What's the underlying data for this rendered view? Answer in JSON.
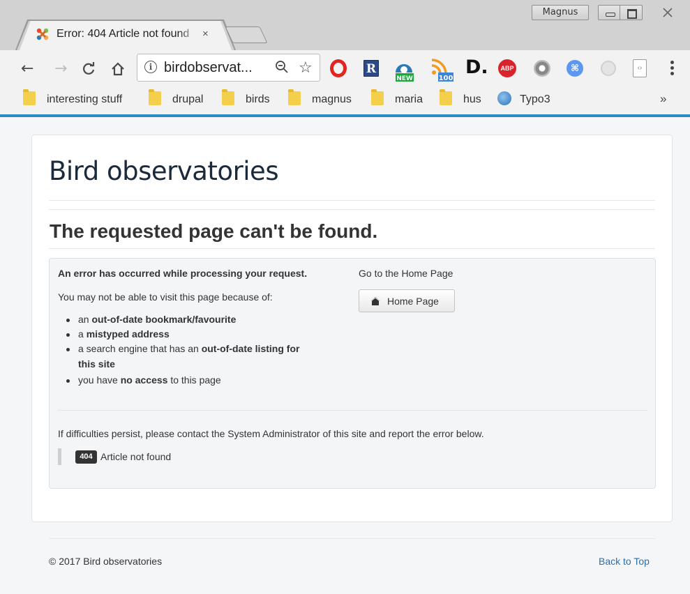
{
  "browser": {
    "profile_name": "Magnus",
    "tab_title": "Error: 404 Article not found",
    "tab_close": "×",
    "url_display": "birdobservat...",
    "ext_r_label": "R",
    "ext_new_label": "NEW",
    "ext_rss_count": "100",
    "ext_d_label": "D.",
    "ext_abp_label": "ABP",
    "bookmarks": [
      {
        "label": "interesting stuff",
        "icon": "folder-icon"
      },
      {
        "label": "drupal",
        "icon": "folder-icon"
      },
      {
        "label": "birds",
        "icon": "folder-icon"
      },
      {
        "label": "magnus",
        "icon": "folder-icon"
      },
      {
        "label": "maria",
        "icon": "folder-icon"
      },
      {
        "label": "hus",
        "icon": "folder-icon"
      },
      {
        "label": "Typo3",
        "icon": "globe-icon"
      }
    ],
    "bookmarks_more": "»",
    "accent_color": "#2a8bcb"
  },
  "page": {
    "site_title": "Bird observatories",
    "heading": "The requested page can't be found.",
    "error_intro": "An error has occurred while processing your request.",
    "reasons_intro": "You may not be able to visit this page because of:",
    "reasons": [
      {
        "pre": "an ",
        "bold": "out-of-date bookmark/favourite",
        "post": ""
      },
      {
        "pre": "a ",
        "bold": "mistyped address",
        "post": ""
      },
      {
        "pre": "a search engine that has an ",
        "bold": "out-of-date listing for",
        "post": ""
      },
      {
        "pre": "",
        "bold": "this site",
        "post": ""
      },
      {
        "pre": "you have ",
        "bold": "no access",
        "post": " to this page"
      }
    ],
    "go_home_text": "Go to the Home Page",
    "home_button": "Home Page",
    "contact_text": "If difficulties persist, please contact the System Administrator of this site and report the error below.",
    "error_code": "404",
    "error_message": "Article not found"
  },
  "footer": {
    "copyright": "© 2017 Bird observatories",
    "back_to_top": "Back to Top"
  }
}
